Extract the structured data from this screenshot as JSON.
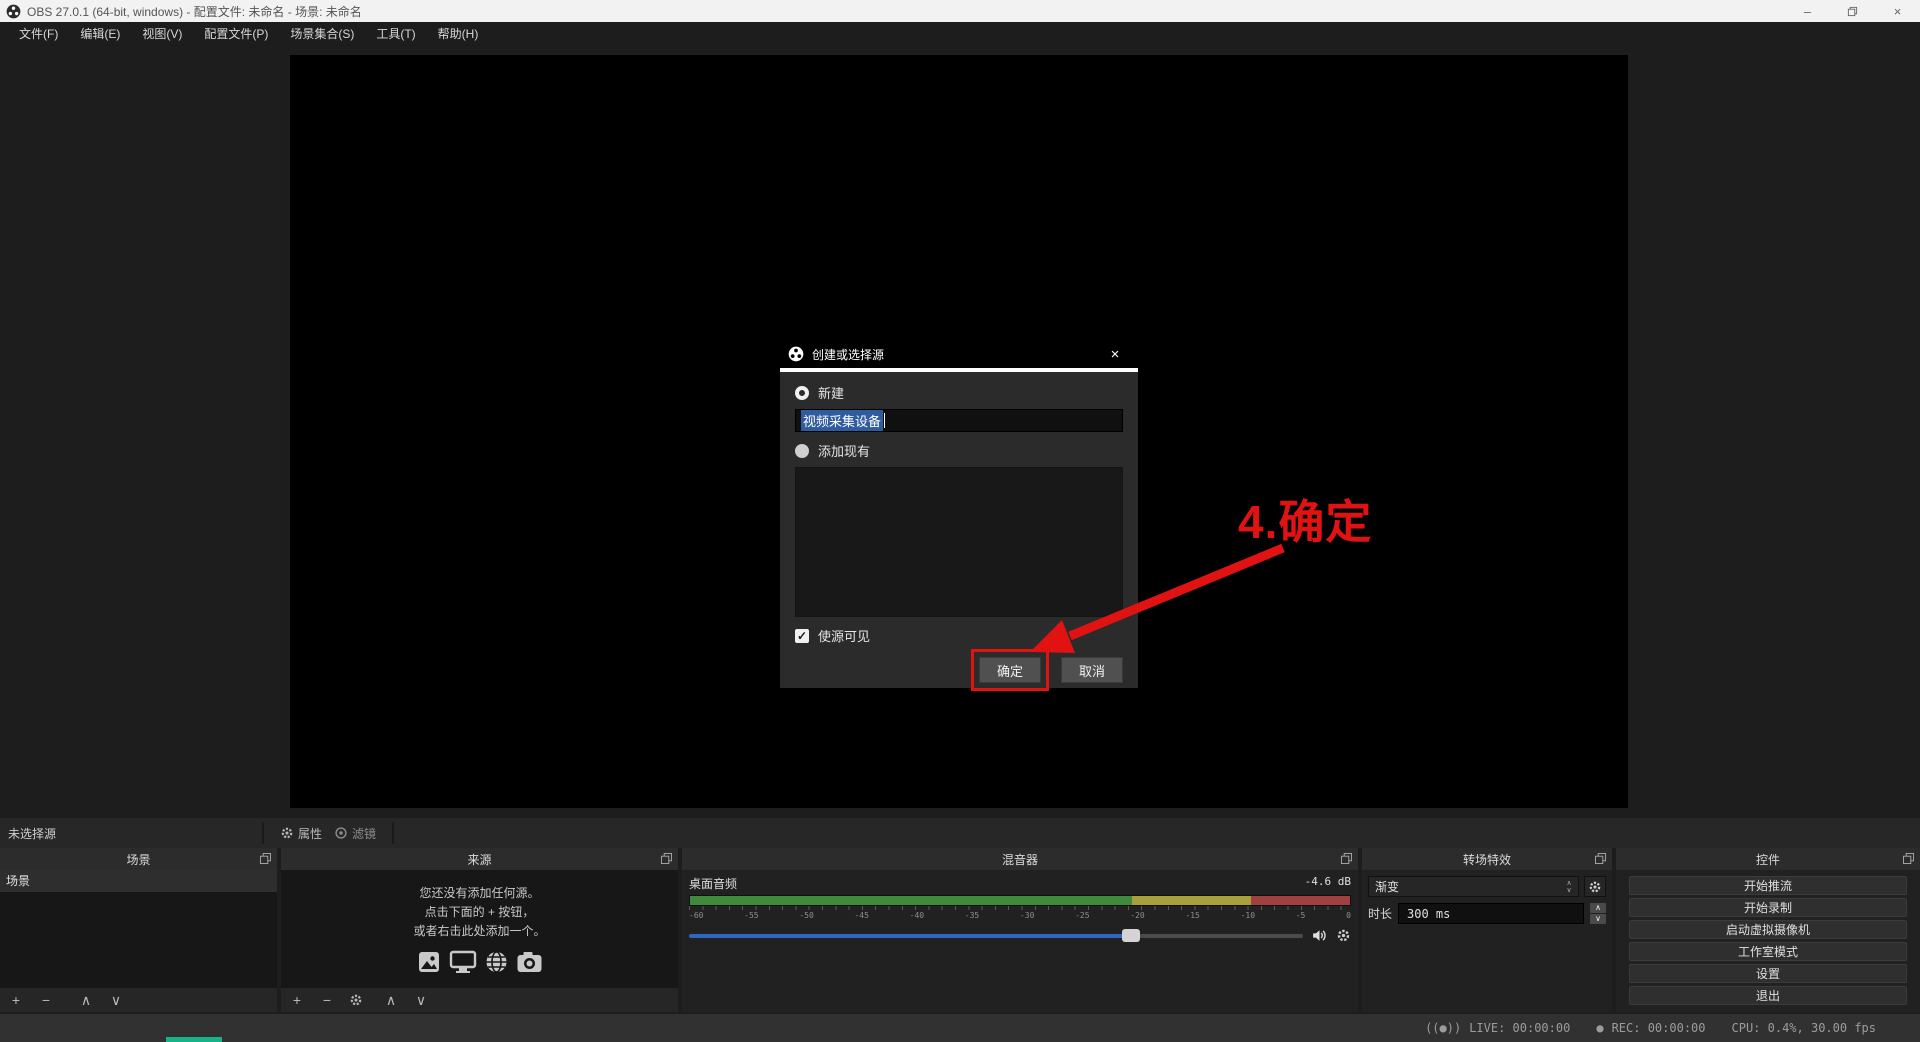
{
  "window": {
    "title": "OBS 27.0.1 (64-bit, windows) - 配置文件: 未命名 - 场景: 未命名"
  },
  "menu": {
    "items": [
      "文件(F)",
      "编辑(E)",
      "视图(V)",
      "配置文件(P)",
      "场景集合(S)",
      "工具(T)",
      "帮助(H)"
    ]
  },
  "dialog": {
    "title": "创建或选择源",
    "radio_new_label": "新建",
    "name_input_value": "视频采集设备",
    "radio_existing_label": "添加现有",
    "visible_checkbox_label": "使源可见",
    "ok_label": "确定",
    "cancel_label": "取消"
  },
  "annotation": {
    "label": "4.确定",
    "color": "#e01212"
  },
  "source_toolbar": {
    "no_source": "未选择源",
    "properties_label": "属性",
    "filters_label": "滤镜"
  },
  "panels": {
    "scenes": {
      "title": "场景",
      "items": [
        "场景"
      ]
    },
    "sources": {
      "title": "来源",
      "empty_lines": [
        "您还没有添加任何源。",
        "点击下面的 + 按钮，",
        "或者右击此处添加一个。"
      ]
    },
    "mixer": {
      "title": "混音器",
      "channel": "桌面音频",
      "level": "-4.6 dB",
      "ticks": [
        "-60",
        "-55",
        "-50",
        "-45",
        "-40",
        "-35",
        "-30",
        "-25",
        "-20",
        "-15",
        "-10",
        "-5",
        "0"
      ],
      "meter_green_pct": 67,
      "meter_yellow_pct": 18,
      "meter_red_pct": 15,
      "volume_pct": 72,
      "colors": {
        "green": "#3f8a3b",
        "yellow": "#a8a03b",
        "red": "#a04040",
        "volume": "#2f66c0"
      }
    },
    "transitions": {
      "title": "转场特效",
      "selected": "渐变",
      "duration_label": "时长",
      "duration_value": "300 ms"
    },
    "controls": {
      "title": "控件",
      "buttons": [
        "开始推流",
        "开始录制",
        "启动虚拟摄像机",
        "工作室模式",
        "设置",
        "退出"
      ]
    }
  },
  "statusbar": {
    "live": "LIVE: 00:00:00",
    "rec": "REC: 00:00:00",
    "cpu": "CPU: 0.4%, 30.00 fps"
  },
  "icons": {
    "minimize": "–",
    "close_x": "×",
    "plus": "+",
    "minus": "−",
    "up": "∧",
    "down": "∨",
    "check": "✓",
    "live_badge": "((●))",
    "dot": "●",
    "combo_up": "∧",
    "combo_down": "∨"
  }
}
